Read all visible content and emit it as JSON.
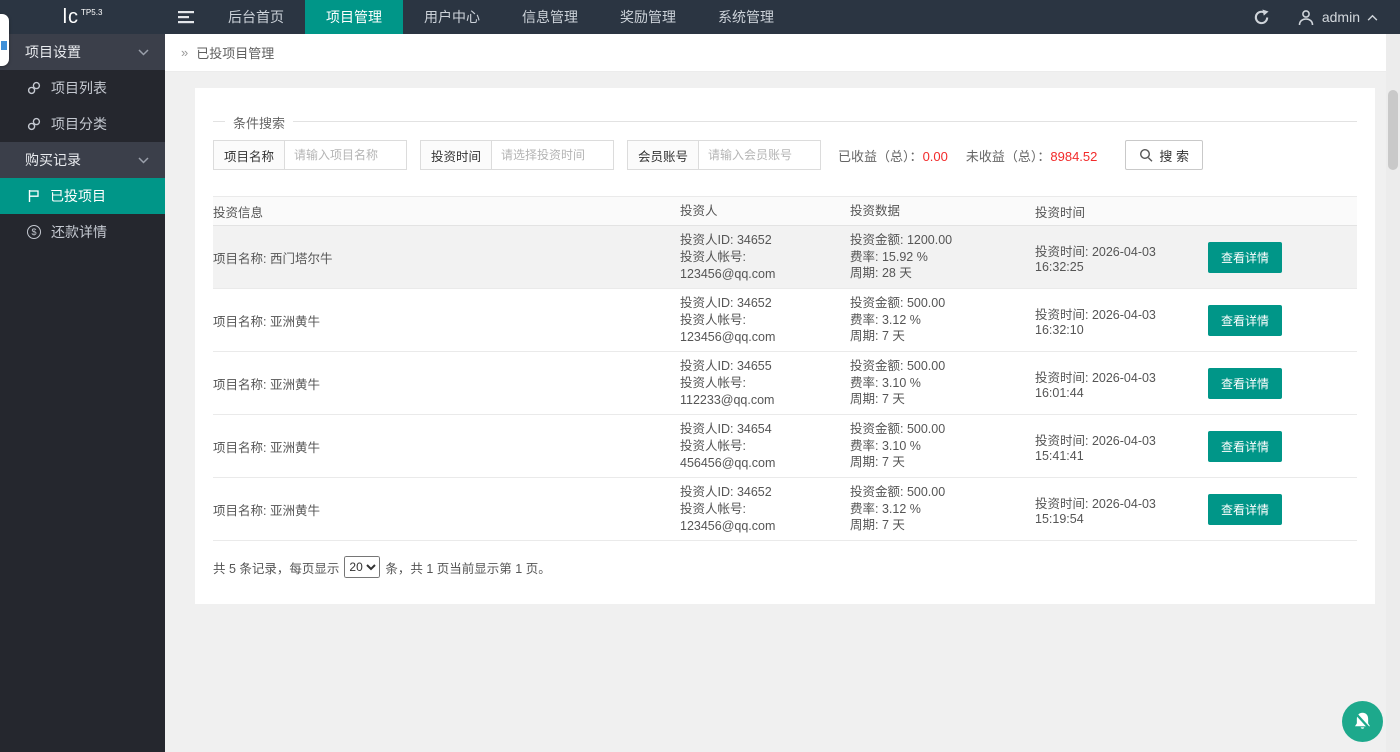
{
  "colors": {
    "accent_teal": "#009688",
    "alert_red": "#f22b2b",
    "bell_green": "#1da98c",
    "navbar_bg": "#2b3542",
    "sidebar_bg": "#25272e"
  },
  "navbar": {
    "logo": "lc",
    "logo_sup": "TP5.3",
    "items": [
      {
        "label": "后台首页"
      },
      {
        "label": "项目管理"
      },
      {
        "label": "用户中心"
      },
      {
        "label": "信息管理"
      },
      {
        "label": "奖励管理"
      },
      {
        "label": "系统管理"
      }
    ],
    "admin_label": "admin"
  },
  "sidebar": {
    "items": [
      {
        "label": "项目设置",
        "type": "group",
        "icon": "chevron-down"
      },
      {
        "label": "项目列表",
        "type": "item",
        "icon": "link"
      },
      {
        "label": "项目分类",
        "type": "item",
        "icon": "link"
      },
      {
        "label": "购买记录",
        "type": "group",
        "icon": "chevron-down"
      },
      {
        "label": "已投项目",
        "type": "item",
        "icon": "flag",
        "active": true
      },
      {
        "label": "还款详情",
        "type": "item",
        "icon": "dollar-circle",
        "glyph": "$"
      }
    ]
  },
  "breadcrumb": {
    "marker": "»",
    "title": "已投项目管理"
  },
  "search": {
    "legend": "条件搜索",
    "fields": [
      {
        "label": "项目名称",
        "placeholder": "请输入项目名称"
      },
      {
        "label": "投资时间",
        "placeholder": "请选择投资时间"
      },
      {
        "label": "会员账号",
        "placeholder": "请输入会员账号"
      }
    ],
    "stats": [
      {
        "label": "已收益（总）：",
        "value": "0.00"
      },
      {
        "label": "未收益（总）：",
        "value": "8984.52"
      }
    ],
    "button_label": "搜 索"
  },
  "table": {
    "headers": [
      "投资信息",
      "投资人",
      "投资数据",
      "投资时间"
    ],
    "rows": [
      {
        "project": "项目名称: 西门塔尔牛",
        "investor_id": "投资人ID: 34652",
        "investor_account": "投资人帐号: 123456@qq.com",
        "amount": "投资金额: 1200.00",
        "rate": "费率: 15.92 %",
        "cycle": "周期: 28 天",
        "time": "投资时间: 2026-04-03 16:32:25",
        "action": "查看详情"
      },
      {
        "project": "项目名称: 亚洲黄牛",
        "investor_id": "投资人ID: 34652",
        "investor_account": "投资人帐号: 123456@qq.com",
        "amount": "投资金额: 500.00",
        "rate": "费率: 3.12 %",
        "cycle": "周期: 7 天",
        "time": "投资时间: 2026-04-03 16:32:10",
        "action": "查看详情"
      },
      {
        "project": "项目名称: 亚洲黄牛",
        "investor_id": "投资人ID: 34655",
        "investor_account": "投资人帐号: 112233@qq.com",
        "amount": "投资金额: 500.00",
        "rate": "费率: 3.10 %",
        "cycle": "周期: 7 天",
        "time": "投资时间: 2026-04-03 16:01:44",
        "action": "查看详情"
      },
      {
        "project": "项目名称: 亚洲黄牛",
        "investor_id": "投资人ID: 34654",
        "investor_account": "投资人帐号: 456456@qq.com",
        "amount": "投资金额: 500.00",
        "rate": "费率: 3.10 %",
        "cycle": "周期: 7 天",
        "time": "投资时间: 2026-04-03 15:41:41",
        "action": "查看详情"
      },
      {
        "project": "项目名称: 亚洲黄牛",
        "investor_id": "投资人ID: 34652",
        "investor_account": "投资人帐号: 123456@qq.com",
        "amount": "投资金额: 500.00",
        "rate": "费率: 3.12 %",
        "cycle": "周期: 7 天",
        "time": "投资时间: 2026-04-03 15:19:54",
        "action": "查看详情"
      }
    ]
  },
  "pagination": {
    "prefix": "共 5 条记录，每页显示",
    "page_size": "20",
    "suffix": "条，共 1 页当前显示第 1 页。"
  }
}
